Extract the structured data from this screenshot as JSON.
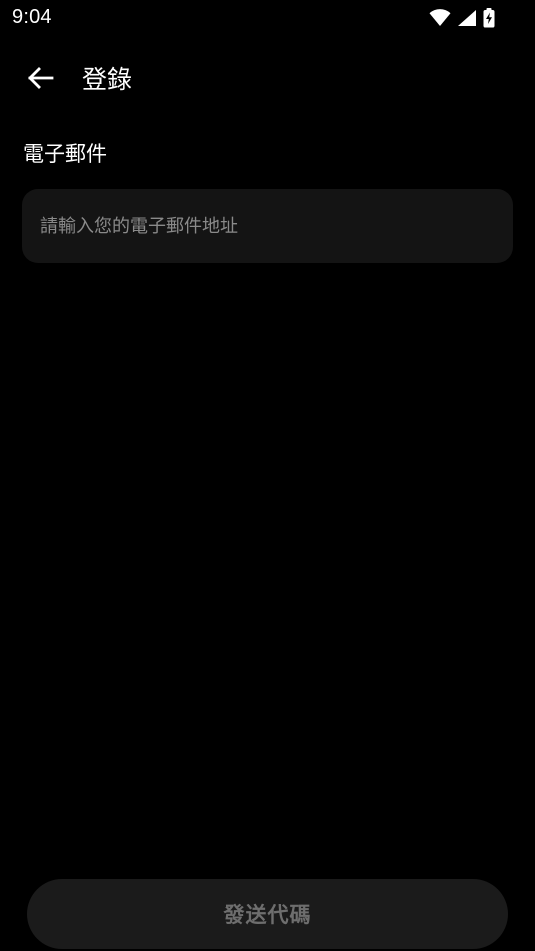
{
  "status_bar": {
    "time": "9:04",
    "icons": [
      "wifi-icon",
      "cellular-signal-icon",
      "battery-charging-icon"
    ]
  },
  "header": {
    "back_icon": "arrow-left-icon",
    "title": "登錄"
  },
  "form": {
    "email_label": "電子郵件",
    "email_value": "",
    "email_placeholder": "請輸入您的電子郵件地址"
  },
  "footer": {
    "send_code_label": "發送代碼"
  },
  "colors": {
    "background": "#000000",
    "input_background": "#141414",
    "button_background": "#1b1b1b",
    "button_text_disabled": "#6e6e6e",
    "placeholder": "#8a8a8a"
  }
}
